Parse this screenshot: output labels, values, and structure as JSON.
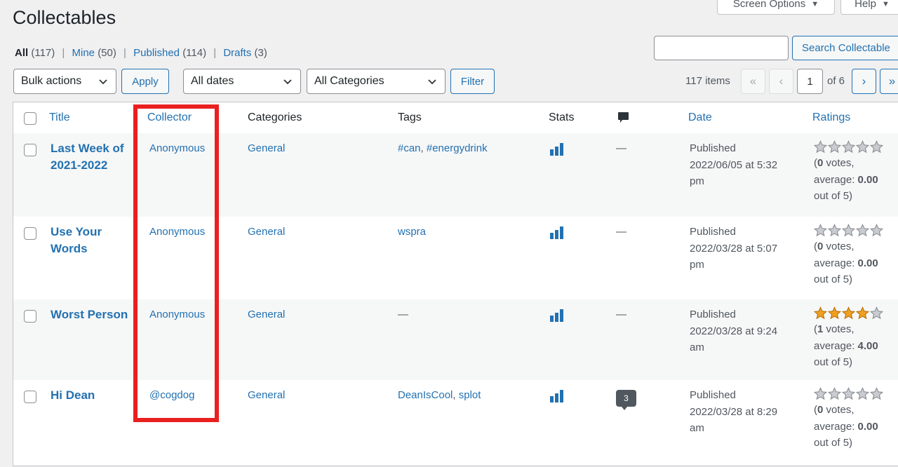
{
  "page": {
    "title": "Collectables",
    "screen_options_label": "Screen Options",
    "help_label": "Help"
  },
  "views": [
    {
      "label": "All",
      "count": "(117)"
    },
    {
      "label": "Mine",
      "count": "(50)"
    },
    {
      "label": "Published",
      "count": "(114)"
    },
    {
      "label": "Drafts",
      "count": "(3)"
    }
  ],
  "search": {
    "button_label": "Search Collectable",
    "value": ""
  },
  "filters": {
    "bulk_actions": "Bulk actions",
    "apply_label": "Apply",
    "dates": "All dates",
    "categories": "All Categories",
    "filter_label": "Filter"
  },
  "pagination": {
    "items": "117 items",
    "first": "«",
    "prev": "‹",
    "current_page": "1",
    "of_label": "of 6",
    "next": "›",
    "last": "»"
  },
  "columns": {
    "title": "Title",
    "collector": "Collector",
    "categories": "Categories",
    "tags": "Tags",
    "stats": "Stats",
    "date": "Date",
    "ratings": "Ratings"
  },
  "rows": [
    {
      "title_line1": "Last Week of",
      "title_line2": "2021-2022",
      "collector": "Anonymous",
      "category": "General",
      "tag1": "#can",
      "tag_sep": ", ",
      "tag2": "#energydrink",
      "comments": "—",
      "status": "Published",
      "date_line1": "2022/06/05 at 5:32",
      "date_line2": "pm",
      "votes": "0",
      "votes_label": " votes,",
      "avg_label": "average: ",
      "average": "0.00",
      "out_of": "out of 5)",
      "rating_value": 0
    },
    {
      "title_line1": "Use Your",
      "title_line2": "Words",
      "collector": "Anonymous",
      "category": "General",
      "tag1": "wspra",
      "tag_sep": "",
      "tag2": "",
      "comments": "—",
      "status": "Published",
      "date_line1": "2022/03/28 at 5:07",
      "date_line2": "pm",
      "votes": "0",
      "votes_label": " votes,",
      "avg_label": "average: ",
      "average": "0.00",
      "out_of": "out of 5)",
      "rating_value": 0
    },
    {
      "title_line1": "Worst Person",
      "title_line2": "",
      "collector": "Anonymous",
      "category": "General",
      "tag1": "—",
      "tag_sep": "",
      "tag2": "",
      "comments": "—",
      "status": "Published",
      "date_line1": "2022/03/28 at 9:24",
      "date_line2": "am",
      "votes": "1",
      "votes_label": " votes,",
      "avg_label": "average: ",
      "average": "4.00",
      "out_of": "out of 5)",
      "rating_value": 4
    },
    {
      "title_line1": "Hi Dean",
      "title_line2": "",
      "collector": "@cogdog",
      "category": "General",
      "tag1": "DeanIsCool",
      "tag_sep": ", ",
      "tag2": "splot",
      "comments": "3",
      "status": "Published",
      "date_line1": "2022/03/28 at 8:29",
      "date_line2": "am",
      "votes": "0",
      "votes_label": " votes,",
      "avg_label": "average: ",
      "average": "0.00",
      "out_of": "out of 5)",
      "rating_value": 0
    }
  ],
  "colors": {
    "link": "#2271b1",
    "highlight": "#ea2020",
    "star_filled": "#f0a020",
    "star_empty": "#8c8f94"
  },
  "icons": {
    "stats": "bar-chart-icon",
    "comments_header": "comment-bubble-icon",
    "chevron": "chevron-down-icon",
    "star": "star-icon"
  }
}
